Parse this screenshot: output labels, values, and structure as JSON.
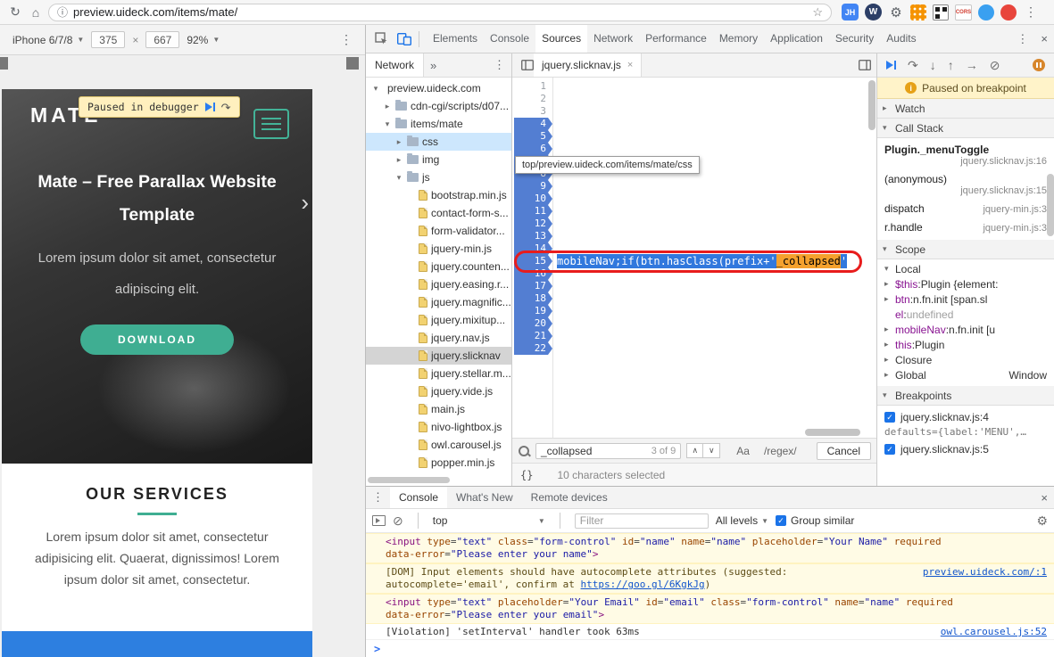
{
  "icons": {
    "reload": "↻",
    "home": "⌂",
    "info": "ⓘ",
    "star": "☆",
    "menu": "⋮",
    "close": "×",
    "dropdown": "▼",
    "open": "▾",
    "closed": "▸",
    "overflow": "»",
    "cloud": "☁",
    "step_over": "↷",
    "step_into": "↓",
    "step_out": "↑",
    "step": "→",
    "deactivate_breakpoints": "⊘",
    "clear_console": "⊘",
    "gear": "⚙",
    "pretty_print": "{}",
    "carousel_next": "›",
    "check": "✓",
    "search_up": "∧",
    "search_down": "∨",
    "times": "×"
  },
  "browser_bar": {
    "url": "preview.uideck.com/items/mate/",
    "avatar": "JH",
    "wp_badge": "W",
    "cors_badge": "CORS"
  },
  "device_toolbar": {
    "device": "iPhone 6/7/8",
    "width": "375",
    "times": "×",
    "height": "667",
    "zoom": "92%"
  },
  "site": {
    "logo": "MATE",
    "debug_banner": "Paused in debugger",
    "hero_title": "Mate – Free Parallax Website Template",
    "hero_subtitle": "Lorem ipsum dolor sit amet, consectetur adipiscing elit.",
    "download_label": "DOWNLOAD",
    "services_title": "OUR SERVICES",
    "services_text": "Lorem ipsum dolor sit amet, consectetur adipisicing elit. Quaerat, dignissimos! Lorem ipsum dolor sit amet, consectetur."
  },
  "devtools": {
    "panel_tabs": [
      "Elements",
      "Console",
      "Sources",
      "Network",
      "Performance",
      "Memory",
      "Application",
      "Security",
      "Audits"
    ],
    "active_panel": "Sources",
    "navigator": {
      "tab_label": "Network",
      "tree": [
        {
          "depth": 0,
          "arrow": "open",
          "icon": "cloud",
          "label": "preview.uideck.com"
        },
        {
          "depth": 1,
          "arrow": "closed",
          "icon": "folder",
          "label": "cdn-cgi/scripts/d07..."
        },
        {
          "depth": 1,
          "arrow": "open",
          "icon": "folder",
          "label": "items/mate"
        },
        {
          "depth": 2,
          "arrow": "closed",
          "icon": "folder",
          "label": "css",
          "state": "hover"
        },
        {
          "depth": 2,
          "arrow": "closed",
          "icon": "folder",
          "label": "img"
        },
        {
          "depth": 2,
          "arrow": "open",
          "icon": "folder",
          "label": "js"
        },
        {
          "depth": 3,
          "icon": "file",
          "label": "bootstrap.min.js"
        },
        {
          "depth": 3,
          "icon": "file",
          "label": "contact-form-s..."
        },
        {
          "depth": 3,
          "icon": "file",
          "label": "form-validator..."
        },
        {
          "depth": 3,
          "icon": "file",
          "label": "jquery-min.js"
        },
        {
          "depth": 3,
          "icon": "file",
          "label": "jquery.counten..."
        },
        {
          "depth": 3,
          "icon": "file",
          "label": "jquery.easing.r..."
        },
        {
          "depth": 3,
          "icon": "file",
          "label": "jquery.magnific..."
        },
        {
          "depth": 3,
          "icon": "file",
          "label": "jquery.mixitup..."
        },
        {
          "depth": 3,
          "icon": "file",
          "label": "jquery.nav.js"
        },
        {
          "depth": 3,
          "icon": "file",
          "label": "jquery.slicknav",
          "state": "selected"
        },
        {
          "depth": 3,
          "icon": "file",
          "label": "jquery.stellar.m..."
        },
        {
          "depth": 3,
          "icon": "file",
          "label": "jquery.vide.js"
        },
        {
          "depth": 3,
          "icon": "file",
          "label": "main.js"
        },
        {
          "depth": 3,
          "icon": "file",
          "label": "nivo-lightbox.js"
        },
        {
          "depth": 3,
          "icon": "file",
          "label": "owl.carousel.js"
        },
        {
          "depth": 3,
          "icon": "file",
          "label": "popper.min.js"
        }
      ]
    },
    "editor": {
      "file_tab": "jquery.slicknav.js",
      "tooltip": "top/preview.uideck.com/items/mate/css",
      "total_lines": 22,
      "breakpoint_lines": [
        4,
        5,
        6,
        7,
        8,
        9,
        10,
        11,
        12,
        13,
        14,
        15,
        16,
        17,
        18,
        19,
        20,
        21,
        22
      ],
      "active_line": 15,
      "active_line_code": {
        "pre": "mobileNav;if(btn.hasClass(prefix+'",
        "match": "_collapsed",
        "post": "'"
      },
      "search": {
        "query": "_collapsed",
        "results": "3 of 9",
        "case_toggle": "Aa",
        "regex_toggle": "/regex/",
        "cancel": "Cancel"
      },
      "status": "10 characters selected"
    },
    "debugger": {
      "paused_message": "Paused on breakpoint",
      "sections": {
        "watch": "Watch",
        "call_stack": "Call Stack",
        "scope": "Scope",
        "breakpoints": "Breakpoints"
      },
      "call_stack": [
        {
          "name": "Plugin._menuToggle",
          "location": "jquery.slicknav.js:16",
          "wrap": true,
          "current": true
        },
        {
          "name": "(anonymous)",
          "location": "jquery.slicknav.js:15",
          "wrap": true
        },
        {
          "name": "dispatch",
          "location": "jquery-min.js:3"
        },
        {
          "name": "r.handle",
          "location": "jquery-min.js:3"
        }
      ],
      "scope": [
        {
          "kind": "group",
          "arrow": "open",
          "label": "Local"
        },
        {
          "kind": "prop",
          "arrow": "closed",
          "name": "$this",
          "value": "Plugin {element:"
        },
        {
          "kind": "prop",
          "arrow": "closed",
          "name": "btn",
          "value": "n.fn.init [span.sl"
        },
        {
          "kind": "prop",
          "arrow": null,
          "name": "el",
          "value": "undefined",
          "muted": true
        },
        {
          "kind": "prop",
          "arrow": "closed",
          "name": "mobileNav",
          "value": "n.fn.init [u"
        },
        {
          "kind": "prop",
          "arrow": "closed",
          "name": "this",
          "value": "Plugin"
        },
        {
          "kind": "group",
          "arrow": "closed",
          "label": "Closure"
        },
        {
          "kind": "group",
          "arrow": "closed",
          "label": "Global",
          "right": "Window"
        }
      ],
      "breakpoints": [
        {
          "label": "jquery.slicknav.js:4",
          "preview": "defaults={label:'MENU',…",
          "checked": true
        },
        {
          "label": "jquery.slicknav.js:5",
          "checked": true
        }
      ]
    },
    "console": {
      "tabs": [
        "Console",
        "What's New",
        "Remote devices"
      ],
      "active_tab": "Console",
      "context": "top",
      "filter_placeholder": "Filter",
      "levels": "All levels",
      "group_similar": "Group similar",
      "prompt": ">",
      "messages": [
        {
          "kind": "warning",
          "html_lines": [
            "<input type=\"text\" class=\"form-control\" id=\"name\" name=\"name\" placeholder=\"Your Name\" required",
            "data-error=\"Please enter your name\">"
          ]
        },
        {
          "kind": "warning",
          "text_lines": [
            [
              {
                "t": "[DOM] Input elements should have autocomplete attributes (suggested:"
              }
            ],
            [
              {
                "t": "autocomplete='email', confirm at "
              },
              {
                "t": "https://goo.gl/6KgkJg",
                "link": true
              },
              {
                "t": ")"
              }
            ]
          ],
          "source_link": "preview.uideck.com/:1"
        },
        {
          "kind": "warning",
          "html_lines": [
            "<input type=\"text\" placeholder=\"Your Email\" id=\"email\" class=\"form-control\" name=\"name\" required",
            "data-error=\"Please enter your email\">"
          ]
        },
        {
          "kind": "violation",
          "text_lines": [
            [
              {
                "t": "[Violation] 'setInterval' handler took 63ms"
              }
            ]
          ],
          "source_link": "owl.carousel.js:52"
        }
      ]
    }
  }
}
